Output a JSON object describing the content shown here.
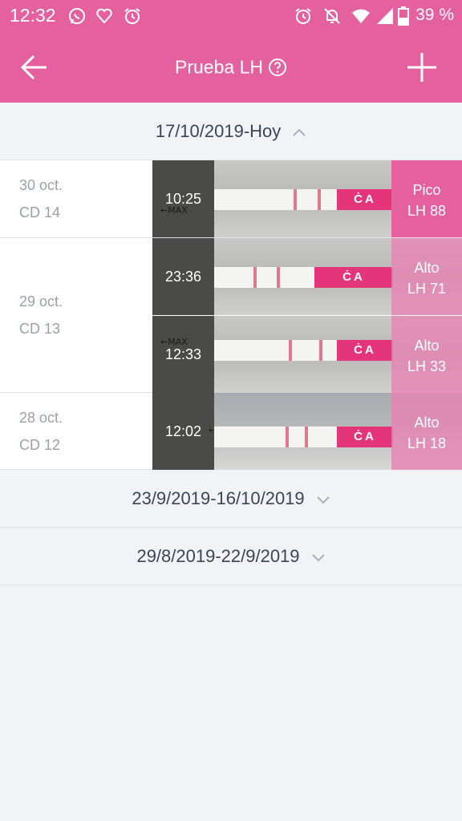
{
  "status_bar": {
    "time": "12:32",
    "battery": "39 %"
  },
  "app_bar": {
    "title": "Prueba LH"
  },
  "colors": {
    "accent": "#e5609f",
    "background": "#f2f3f7"
  },
  "groups": [
    {
      "range": "17/10/2019-Hoy",
      "expanded": true
    },
    {
      "range": "23/9/2019-16/10/2019",
      "expanded": false
    },
    {
      "range": "29/8/2019-22/9/2019",
      "expanded": false
    }
  ],
  "days": [
    {
      "date": "30 oct.",
      "cycle_day": "CD 14",
      "tests": [
        {
          "time": "10:25",
          "result": "Pico",
          "lh": "LH 88"
        }
      ]
    },
    {
      "date": "29 oct.",
      "cycle_day": "CD 13",
      "tests": [
        {
          "time": "23:36",
          "result": "Alto",
          "lh": "LH 71"
        },
        {
          "time": "12:33",
          "result": "Alto",
          "lh": "LH 33"
        }
      ]
    },
    {
      "date": "28 oct.",
      "cycle_day": "CD 12",
      "tests": [
        {
          "time": "12:02",
          "result": "Alto",
          "lh": "LH 18"
        }
      ]
    }
  ]
}
